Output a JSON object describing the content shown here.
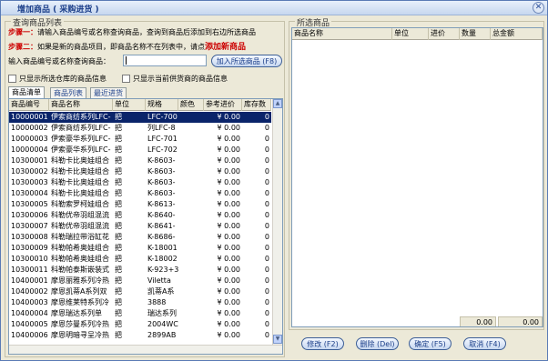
{
  "window": {
    "title": "增加商品 ( 采购进货 )"
  },
  "query_group": {
    "legend": "查询商品列表",
    "step1_label": "步骤一：",
    "step1_text": "请输入商品编号或名称查询商品，查询到商品后添加到右边所选商品",
    "step2_label": "步骤二：",
    "step2_text": "如果是新的商品项目，即商品名称不在列表中，请点",
    "new_product_link": "添加新商品",
    "search_label": "输入商品编号或名称查询商品：",
    "search_value": "",
    "add_selected_button": "加入所选商品 (F8)",
    "check_warehouse": "只显示所选仓库的商品信息",
    "check_supplier": "只显示当前供货商的商品信息",
    "tabs": [
      "商品清单",
      "商品列表",
      "最近进货"
    ],
    "columns": [
      "商品编号",
      "商品名称",
      "单位",
      "规格",
      "颜色",
      "参考进价",
      "库存数"
    ],
    "rows": [
      [
        "10000001",
        "伊索商纺系列LFC-",
        "把",
        "LFC-700",
        "",
        "¥ 0.00",
        "0"
      ],
      [
        "10000002",
        "伊索商纺系列LFC-",
        "把",
        "列LFC-8",
        "",
        "¥ 0.00",
        "0"
      ],
      [
        "10000003",
        "伊索豪华系列LFC-",
        "把",
        "LFC-701",
        "",
        "¥ 0.00",
        "0"
      ],
      [
        "10000004",
        "伊索豪华系列LFC-",
        "把",
        "LFC-702",
        "",
        "¥ 0.00",
        "0"
      ],
      [
        "10300001",
        "科勒卡比奥娃组合",
        "把",
        "K-8603-",
        "",
        "¥ 0.00",
        "0"
      ],
      [
        "10300002",
        "科勒卡比奥娃组合",
        "把",
        "K-8603-",
        "",
        "¥ 0.00",
        "0"
      ],
      [
        "10300003",
        "科勒卡比奥娃组合",
        "把",
        "K-8603-",
        "",
        "¥ 0.00",
        "0"
      ],
      [
        "10300004",
        "科勒卡比奥娃组合",
        "把",
        "K-8603-",
        "",
        "¥ 0.00",
        "0"
      ],
      [
        "10300005",
        "科勒索罗柯娃组合",
        "把",
        "K-8613-",
        "",
        "¥ 0.00",
        "0"
      ],
      [
        "10300006",
        "科勒优帝羽组混流",
        "把",
        "K-8640-",
        "",
        "¥ 0.00",
        "0"
      ],
      [
        "10300007",
        "科勒优帝羽组混流",
        "把",
        "K-8641-",
        "",
        "¥ 0.00",
        "0"
      ],
      [
        "10300008",
        "科勒瑞拉带浴缸花",
        "把",
        "K-8686-",
        "",
        "¥ 0.00",
        "0"
      ],
      [
        "10300009",
        "科勒帕希奥娃组合",
        "把",
        "K-18001",
        "",
        "¥ 0.00",
        "0"
      ],
      [
        "10300010",
        "科勒帕希奥娃组合",
        "把",
        "K-18002",
        "",
        "¥ 0.00",
        "0"
      ],
      [
        "10300011",
        "科勒帕泰斯嵌装式",
        "把",
        "K-923+3",
        "",
        "¥ 0.00",
        "0"
      ],
      [
        "10400001",
        "摩恩丽雅系列冷热",
        "把",
        "Viletta",
        "",
        "¥ 0.00",
        "0"
      ],
      [
        "10400002",
        "摩恩凯蒂A系列双",
        "把",
        "凯蒂A系",
        "",
        "¥ 0.00",
        "0"
      ],
      [
        "10400003",
        "摩恩维莱特系列冷",
        "把",
        "3888",
        "",
        "¥ 0.00",
        "0"
      ],
      [
        "10400004",
        "摩恩瑞达系列单",
        "把",
        "瑞达系列",
        "",
        "¥ 0.00",
        "0"
      ],
      [
        "10400005",
        "摩恩莎曼系列冷热",
        "把",
        "2004WCL",
        "",
        "¥ 0.00",
        "0"
      ],
      [
        "10400006",
        "摩恩明暗寻呈冷热",
        "把",
        "2899AB",
        "",
        "¥ 0.00",
        "0"
      ]
    ]
  },
  "selected_group": {
    "legend": "所选商品",
    "columns": [
      "商品名称",
      "单位",
      "进价",
      "数量",
      "总金额"
    ],
    "rows": [],
    "sum_qty": "0.00",
    "sum_total": "0.00"
  },
  "buttons": {
    "edit": "修改 (F2)",
    "delete": "删除 (Del)",
    "ok": "确定 (F5)",
    "cancel": "取消 (F4)"
  }
}
